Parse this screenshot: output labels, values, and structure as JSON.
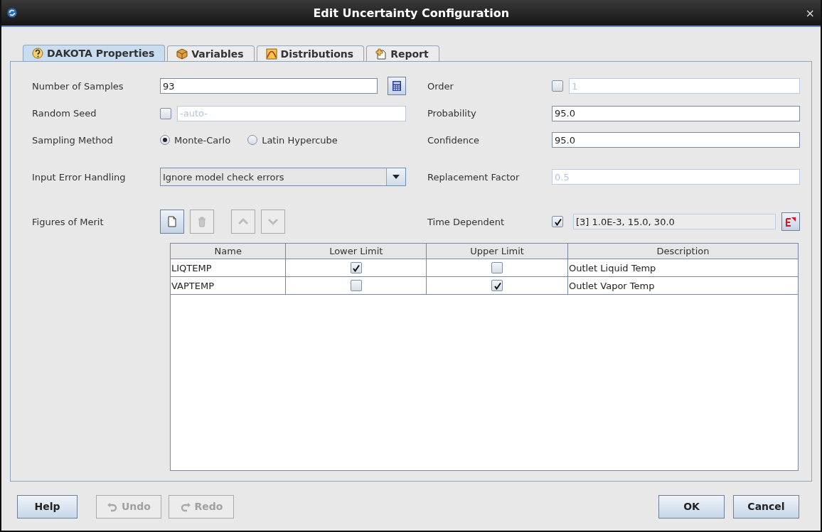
{
  "window": {
    "title": "Edit Uncertainty Configuration",
    "close": "×"
  },
  "tabs": [
    {
      "label": "DAKOTA Properties",
      "kind": "help",
      "selected": true
    },
    {
      "label": "Variables",
      "kind": "box",
      "selected": false
    },
    {
      "label": "Distributions",
      "kind": "curve",
      "selected": false
    },
    {
      "label": "Report",
      "kind": "report",
      "selected": false
    }
  ],
  "rows": [
    {
      "left": {
        "kind": "text_button",
        "label": "Number of Samples",
        "value": "93",
        "disabled": false
      },
      "right": {
        "kind": "check_text",
        "label": "Order",
        "checked": false,
        "value": "1",
        "disabled": true
      }
    },
    {
      "left": {
        "kind": "check_text",
        "label": "Random Seed",
        "checked": false,
        "value": "-auto-",
        "disabled": true
      },
      "right": {
        "kind": "text",
        "label": "Probability",
        "value": "95.0",
        "disabled": false
      }
    },
    {
      "left": {
        "kind": "radio",
        "label": "Sampling Method",
        "options": [
          {
            "label": "Monte-Carlo",
            "selected": true
          },
          {
            "label": "Latin Hypercube",
            "selected": false
          }
        ]
      },
      "right": {
        "kind": "text",
        "label": "Confidence",
        "value": "95.0",
        "disabled": false
      }
    },
    {
      "left": {
        "kind": "combo",
        "label": "Input Error Handling",
        "value": "Ignore model check errors"
      },
      "right": {
        "kind": "text",
        "label": "Replacement Factor",
        "value": "0.5",
        "disabled": true
      }
    },
    {
      "left": {
        "kind": "toolbar",
        "label": "Figures of Merit",
        "buttons": [
          {
            "kind": "new",
            "disabled": false
          },
          {
            "kind": "delete",
            "disabled": true
          },
          {
            "kind": "up",
            "disabled": true
          },
          {
            "kind": "down",
            "disabled": true
          }
        ]
      },
      "right": {
        "kind": "check_display",
        "label": "Time Dependent",
        "checked": true,
        "value": "[3] 1.0E-3, 15.0, 30.0"
      }
    }
  ],
  "table": {
    "columns": [
      "Name",
      "Lower Limit",
      "Upper Limit",
      "Description"
    ],
    "rows": [
      {
        "name": "LIQTEMP",
        "lower_limit": true,
        "upper_limit": false,
        "description": "Outlet Liquid Temp"
      },
      {
        "name": "VAPTEMP",
        "lower_limit": false,
        "upper_limit": true,
        "description": "Outlet Vapor Temp"
      }
    ]
  },
  "footer": {
    "left": [
      {
        "label": "Help",
        "disabled": false
      },
      {
        "label": "Undo",
        "kind": "undo",
        "disabled": true
      },
      {
        "label": "Redo",
        "kind": "redo",
        "disabled": true
      }
    ],
    "right": [
      {
        "label": "OK",
        "disabled": false
      },
      {
        "label": "Cancel",
        "disabled": false
      }
    ]
  }
}
